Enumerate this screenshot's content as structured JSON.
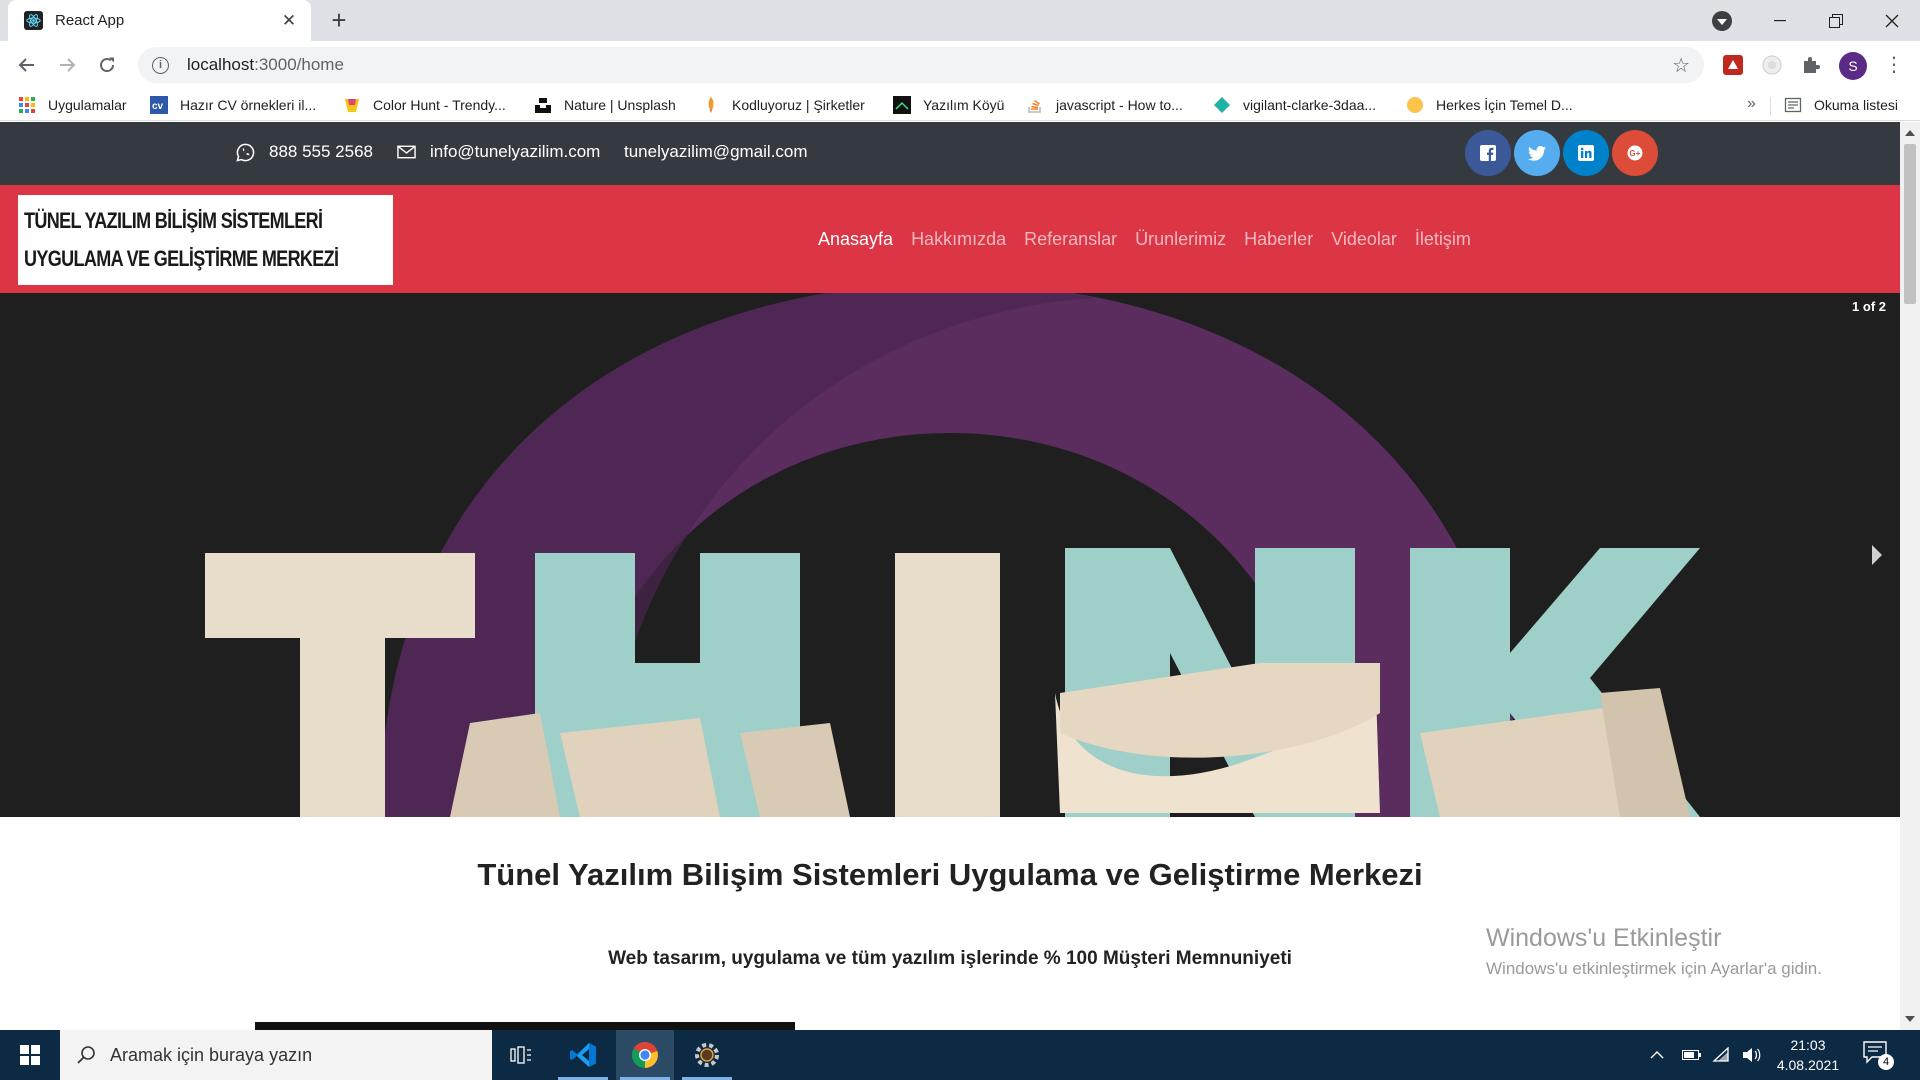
{
  "browser": {
    "tab_title": "React App",
    "url_host": "localhost",
    "url_path": ":3000/home",
    "bookmarks": [
      {
        "label": "Uygulamalar",
        "icon": "apps-grid-icon"
      },
      {
        "label": "Hazır CV örnekleri il...",
        "icon": "cv-icon"
      },
      {
        "label": "Color Hunt - Trendy...",
        "icon": "color-hunt-icon"
      },
      {
        "label": "Nature | Unsplash",
        "icon": "unsplash-icon"
      },
      {
        "label": "Kodluyoruz | Şirketler",
        "icon": "rocket-icon"
      },
      {
        "label": "Yazılım Köyü",
        "icon": "yazilim-koyu-icon"
      },
      {
        "label": "javascript - How to...",
        "icon": "stackoverflow-icon"
      },
      {
        "label": "vigilant-clarke-3daa...",
        "icon": "netlify-icon"
      },
      {
        "label": "Herkes İçin Temel D...",
        "icon": "circle-icon"
      }
    ],
    "reading_list": "Okuma listesi",
    "avatar_letter": "S"
  },
  "topbar": {
    "phone": "888 555 2568",
    "email1": "info@tunelyazilim.com",
    "email2": "tunelyazilim@gmail.com",
    "social": [
      {
        "name": "facebook",
        "color": "#3b5998"
      },
      {
        "name": "twitter",
        "color": "#55acee"
      },
      {
        "name": "linkedin",
        "color": "#0082ca"
      },
      {
        "name": "google-plus",
        "color": "#dd4b39"
      }
    ]
  },
  "logo": {
    "line1": "TÜNEL YAZILIM BİLİŞİM SİSTEMLERİ",
    "line2": "UYGULAMA VE GELİŞTİRME MERKEZİ"
  },
  "menu": [
    {
      "label": "Anasayfa",
      "active": true
    },
    {
      "label": "Hakkımızda",
      "active": false
    },
    {
      "label": "Referanslar",
      "active": false
    },
    {
      "label": "Ürunlerimiz",
      "active": false
    },
    {
      "label": "Haberler",
      "active": false
    },
    {
      "label": "Videolar",
      "active": false
    },
    {
      "label": "İletişim",
      "active": false
    }
  ],
  "carousel": {
    "counter": "1 of 2",
    "slide_text": "THINK",
    "colors": {
      "background": "#1f1f1f",
      "ring": "#5a2d5e",
      "letters_teal": "#9fcfc9",
      "letters_cream": "#e8dccb"
    }
  },
  "content": {
    "heading": "Tünel Yazılım Bilişim Sistemleri Uygulama ve Geliştirme Merkezi",
    "subheading": "Web tasarım, uygulama ve tüm yazılım işlerinde % 100 Müşteri Memnuniyeti"
  },
  "watermark": {
    "line1": "Windows'u Etkinleştir",
    "line2": "Windows'u etkinleştirmek için Ayarlar'a gidin."
  },
  "taskbar": {
    "search_placeholder": "Aramak için buraya yazın",
    "time": "21:03",
    "date": "4.08.2021",
    "notifications": "4"
  }
}
